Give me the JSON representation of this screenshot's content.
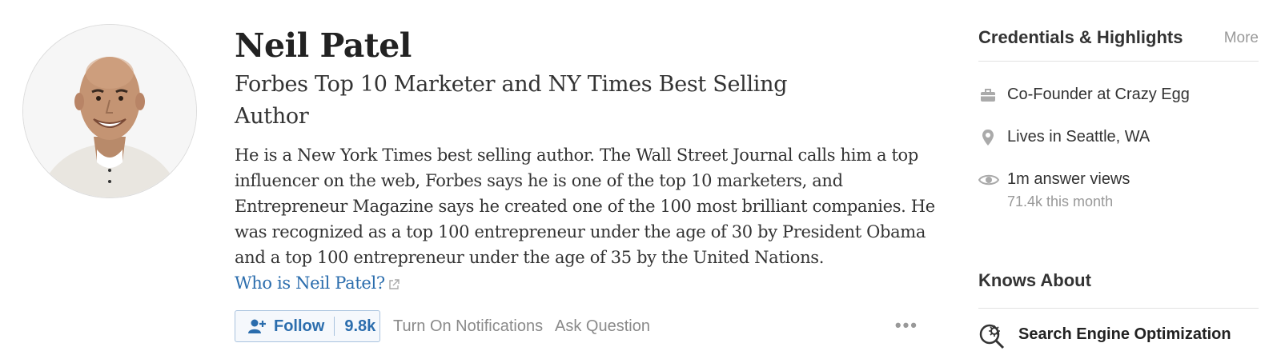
{
  "profile": {
    "name": "Neil Patel",
    "tagline": "Forbes Top 10 Marketer and NY Times Best Selling Author",
    "bio": "He is a New York Times best selling author. The Wall Street Journal calls him a top influencer on the web, Forbes says he is one of the top 10 marketers, and Entrepreneur Magazine says he created one of the 100 most brilliant companies. He was recognized as a top 100 entrepreneur under the age of 30 by President Obama and a top 100 entrepreneur under the age of 35 by the United Nations.",
    "who_link": "Who is Neil Patel?"
  },
  "actions": {
    "follow_label": "Follow",
    "follow_count": "9.8k",
    "notifications_label": "Turn On Notifications",
    "ask_label": "Ask Question",
    "more_label": "•••"
  },
  "credentials": {
    "title": "Credentials & Highlights",
    "more_label": "More",
    "items": [
      {
        "icon": "briefcase-icon",
        "text": "Co-Founder at Crazy Egg"
      },
      {
        "icon": "location-pin-icon",
        "text": "Lives in Seattle, WA"
      },
      {
        "icon": "eye-icon",
        "text": "1m answer views",
        "sub": "71.4k this month"
      }
    ]
  },
  "knows_about": {
    "title": "Knows About",
    "topics": [
      {
        "icon": "search-gear-icon",
        "label": "Search Engine Optimization"
      }
    ]
  },
  "colors": {
    "link": "#2b6dad",
    "muted": "#999999",
    "follow_border": "#a9c3de"
  }
}
